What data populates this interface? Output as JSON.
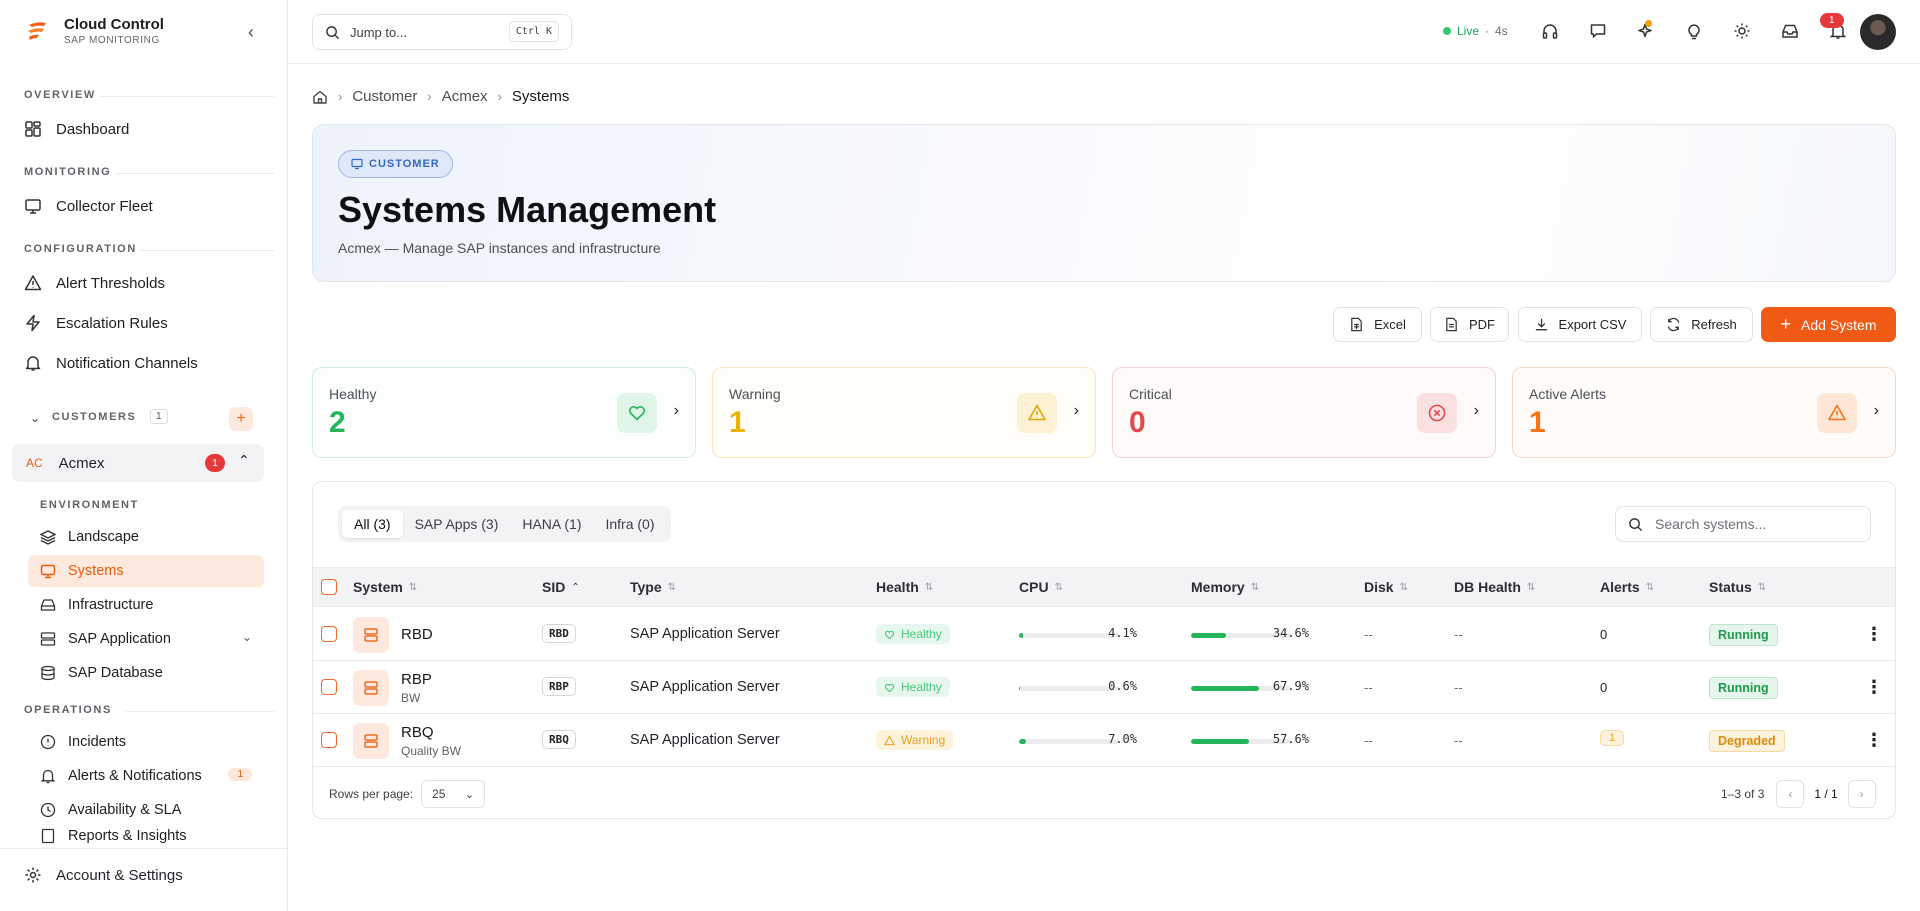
{
  "brand": {
    "title": "Cloud Control",
    "subtitle": "SAP MONITORING"
  },
  "sidebar": {
    "overview_label": "OVERVIEW",
    "dashboard": "Dashboard",
    "monitoring_label": "MONITORING",
    "collector_fleet": "Collector Fleet",
    "configuration_label": "CONFIGURATION",
    "alert_thresholds": "Alert Thresholds",
    "escalation_rules": "Escalation Rules",
    "notification_channels": "Notification Channels",
    "customers_label": "CUSTOMERS",
    "customers_count": "1",
    "customer": {
      "initials": "AC",
      "name": "Acmex",
      "badge": "1"
    },
    "environment_label": "ENVIRONMENT",
    "env_items": [
      "Landscape",
      "Systems",
      "Infrastructure",
      "SAP Application",
      "SAP Database"
    ],
    "operations_label": "OPERATIONS",
    "ops_items": [
      "Incidents",
      "Alerts & Notifications",
      "Availability & SLA",
      "Reports & Insights"
    ],
    "alerts_badge": "1",
    "account": "Account & Settings"
  },
  "topbar": {
    "jump_placeholder": "Jump to...",
    "shortcut": "Ctrl K",
    "live": "Live",
    "live_sep": "·",
    "live_age": "4s",
    "notif_count": "1"
  },
  "breadcrumb": [
    "Customer",
    "Acmex",
    "Systems"
  ],
  "hero": {
    "chip": "CUSTOMER",
    "title": "Systems Management",
    "description": "Acmex — Manage SAP instances and infrastructure"
  },
  "actions": {
    "excel": "Excel",
    "pdf": "PDF",
    "export_csv": "Export CSV",
    "refresh": "Refresh",
    "add": "Add System"
  },
  "stats": [
    {
      "label": "Healthy",
      "value": "2",
      "color": "#22b55a"
    },
    {
      "label": "Warning",
      "value": "1",
      "color": "#eab308"
    },
    {
      "label": "Critical",
      "value": "0",
      "color": "#e5484d"
    },
    {
      "label": "Active Alerts",
      "value": "1",
      "color": "#f97316"
    }
  ],
  "tabs": [
    "All (3)",
    "SAP Apps (3)",
    "HANA (1)",
    "Infra (0)"
  ],
  "search_placeholder": "Search systems...",
  "columns": [
    "System",
    "SID",
    "Type",
    "Health",
    "CPU",
    "Memory",
    "Disk",
    "DB Health",
    "Alerts",
    "Status"
  ],
  "rows": [
    {
      "name": "RBD",
      "sub": "",
      "sid": "RBD",
      "type": "SAP Application Server",
      "health": "Healthy",
      "cpu": 4.1,
      "cpu_text": "4.1%",
      "mem": 34.6,
      "mem_text": "34.6%",
      "disk": "--",
      "db": "--",
      "alerts": "0",
      "status": "Running"
    },
    {
      "name": "RBP",
      "sub": "BW",
      "sid": "RBP",
      "type": "SAP Application Server",
      "health": "Healthy",
      "cpu": 0.6,
      "cpu_text": "0.6%",
      "mem": 67.9,
      "mem_text": "67.9%",
      "disk": "--",
      "db": "--",
      "alerts": "0",
      "status": "Running"
    },
    {
      "name": "RBQ",
      "sub": "Quality BW",
      "sid": "RBQ",
      "type": "SAP Application Server",
      "health": "Warning",
      "cpu": 7.0,
      "cpu_text": "7.0%",
      "mem": 57.6,
      "mem_text": "57.6%",
      "disk": "--",
      "db": "--",
      "alerts": "1",
      "status": "Degraded"
    }
  ],
  "footer": {
    "rows_per_page_label": "Rows per page:",
    "rows_per_page": "25",
    "range": "1–3 of 3",
    "page": "1 / 1"
  }
}
